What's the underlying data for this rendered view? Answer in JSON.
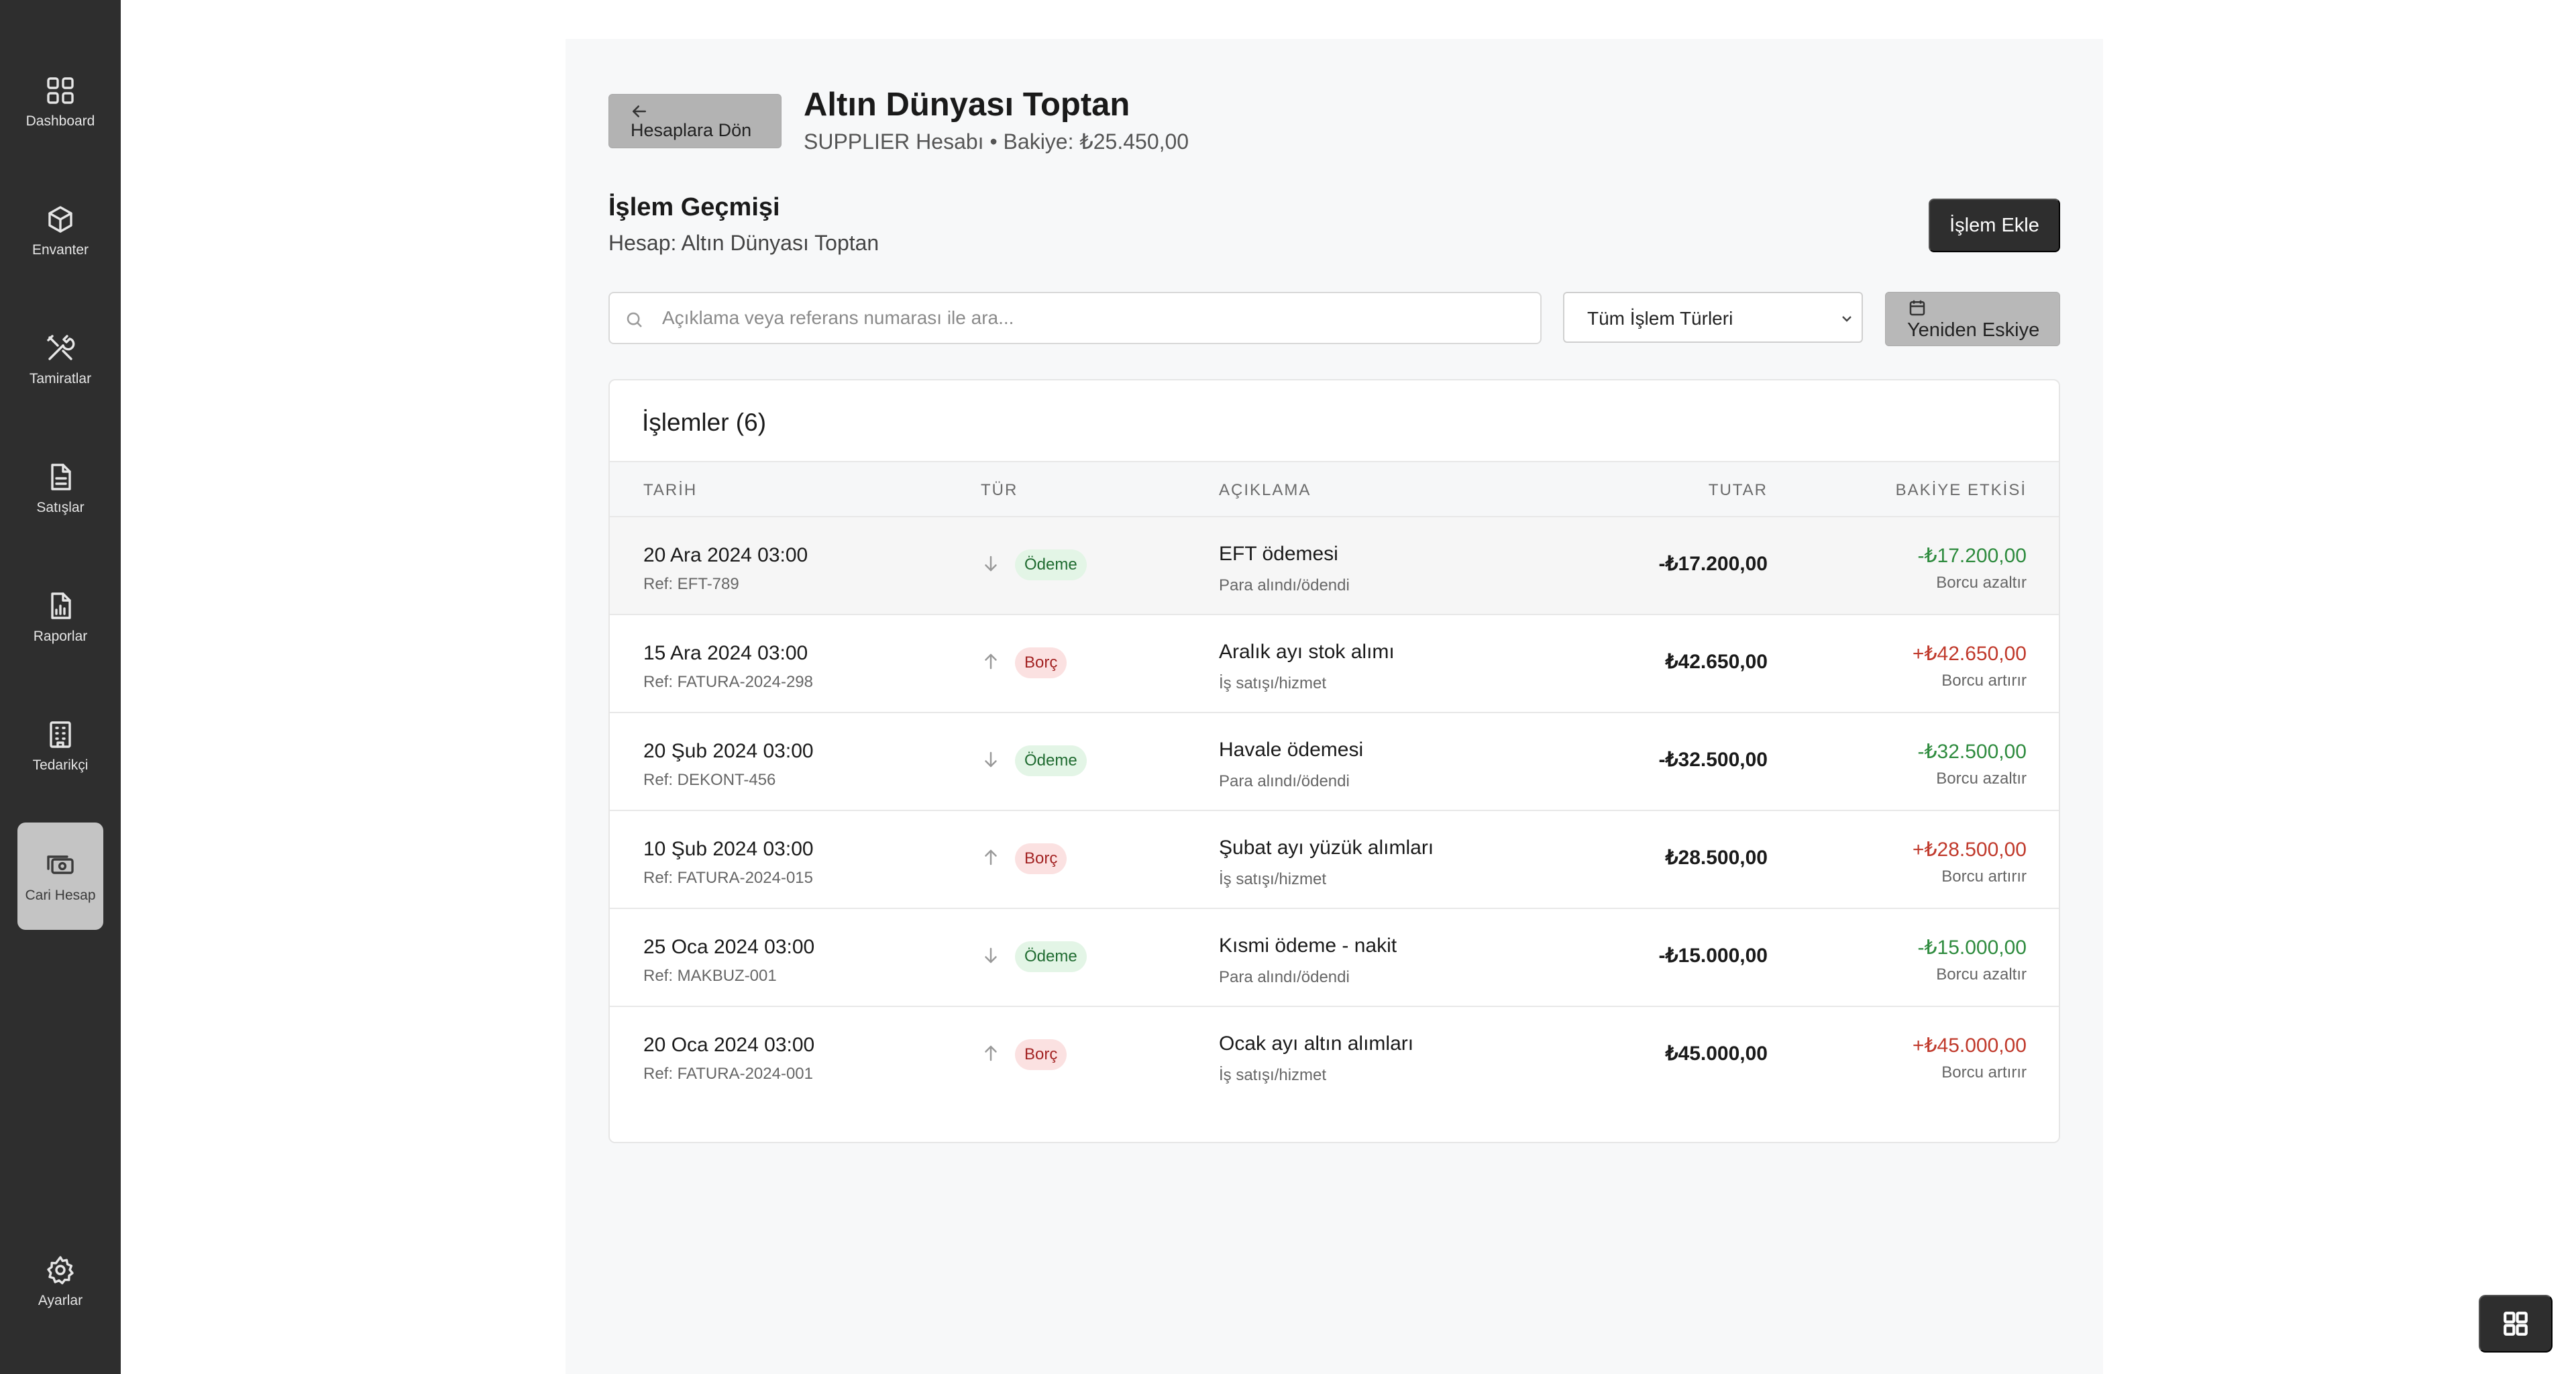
{
  "sidebar": {
    "items": [
      {
        "label": "Dashboard",
        "icon": "dashboard-icon"
      },
      {
        "label": "Envanter",
        "icon": "box-icon"
      },
      {
        "label": "Tamiratlar",
        "icon": "tools-icon"
      },
      {
        "label": "Satışlar",
        "icon": "document-icon"
      },
      {
        "label": "Raporlar",
        "icon": "report-icon"
      },
      {
        "label": "Tedarikçi",
        "icon": "building-icon"
      },
      {
        "label": "Cari Hesap",
        "icon": "wallet-icon",
        "active": true
      }
    ],
    "settings": {
      "label": "Ayarlar",
      "icon": "gear-icon"
    }
  },
  "header": {
    "back_label": "Hesaplara Dön",
    "title": "Altın Dünyası Toptan",
    "subtitle": "SUPPLIER Hesabı • Bakiye: ₺25.450,00"
  },
  "history": {
    "title": "İşlem Geçmişi",
    "subtitle": "Hesap: Altın Dünyası Toptan",
    "add_label": "İşlem Ekle"
  },
  "filters": {
    "search_placeholder": "Açıklama veya referans numarası ile ara...",
    "type_selected": "Tüm İşlem Türleri",
    "sort_label": "Yeniden Eskiye"
  },
  "table": {
    "title": "İşlemler (6)",
    "headers": {
      "date": "TARİH",
      "type": "TÜR",
      "desc": "AÇIKLAMA",
      "amount": "TUTAR",
      "effect": "BAKİYE ETKİSİ"
    },
    "rows": [
      {
        "date": "20 Ara 2024 03:00",
        "ref": "Ref: EFT-789",
        "type": "Ödeme",
        "desc": "EFT ödemesi",
        "desc_sub": "Para alındı/ödendi",
        "amount": "-₺17.200,00",
        "effect": "-₺17.200,00",
        "effect_sub": "Borcu azaltır"
      },
      {
        "date": "15 Ara 2024 03:00",
        "ref": "Ref: FATURA-2024-298",
        "type": "Borç",
        "desc": "Aralık ayı stok alımı",
        "desc_sub": "İş satışı/hizmet",
        "amount": "₺42.650,00",
        "effect": "+₺42.650,00",
        "effect_sub": "Borcu artırır"
      },
      {
        "date": "20 Şub 2024 03:00",
        "ref": "Ref: DEKONT-456",
        "type": "Ödeme",
        "desc": "Havale ödemesi",
        "desc_sub": "Para alındı/ödendi",
        "amount": "-₺32.500,00",
        "effect": "-₺32.500,00",
        "effect_sub": "Borcu azaltır"
      },
      {
        "date": "10 Şub 2024 03:00",
        "ref": "Ref: FATURA-2024-015",
        "type": "Borç",
        "desc": "Şubat ayı yüzük alımları",
        "desc_sub": "İş satışı/hizmet",
        "amount": "₺28.500,00",
        "effect": "+₺28.500,00",
        "effect_sub": "Borcu artırır"
      },
      {
        "date": "25 Oca 2024 03:00",
        "ref": "Ref: MAKBUZ-001",
        "type": "Ödeme",
        "desc": "Kısmi ödeme - nakit",
        "desc_sub": "Para alındı/ödendi",
        "amount": "-₺15.000,00",
        "effect": "-₺15.000,00",
        "effect_sub": "Borcu azaltır"
      },
      {
        "date": "20 Oca 2024 03:00",
        "ref": "Ref: FATURA-2024-001",
        "type": "Borç",
        "desc": "Ocak ayı altın alımları",
        "desc_sub": "İş satışı/hizmet",
        "amount": "₺45.000,00",
        "effect": "+₺45.000,00",
        "effect_sub": "Borcu artırır"
      }
    ]
  },
  "colors": {
    "sidebar_bg": "#2e2e2e",
    "payment_green": "#2e8b3e",
    "debt_red": "#c0392b"
  }
}
